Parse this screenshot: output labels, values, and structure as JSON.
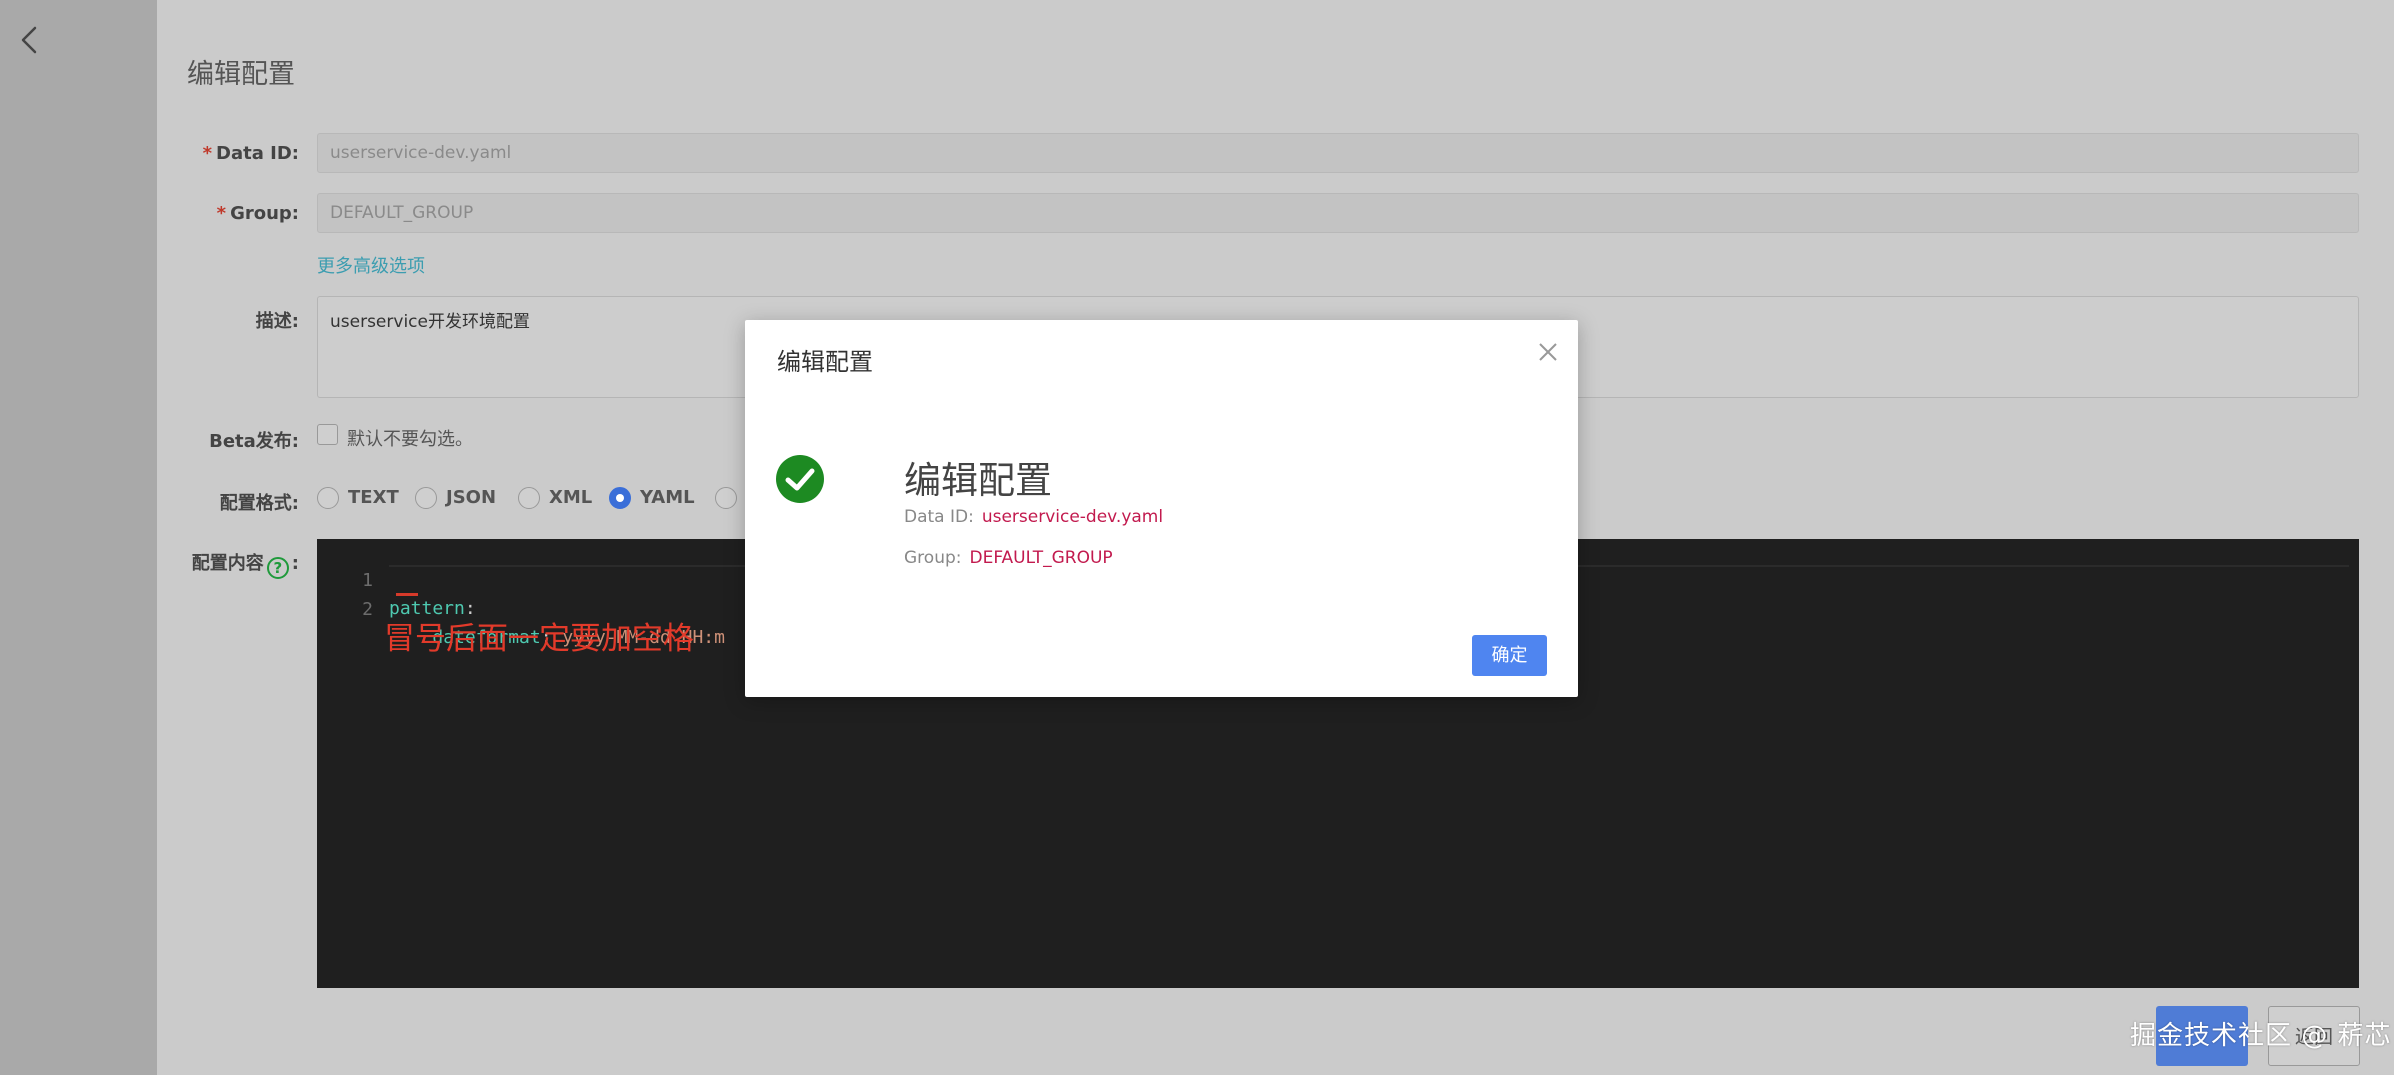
{
  "page": {
    "title": "编辑配置"
  },
  "form": {
    "data_id": {
      "label": "Data ID:",
      "value": "userservice-dev.yaml"
    },
    "group": {
      "label": "Group:",
      "value": "DEFAULT_GROUP"
    },
    "advanced_link": "更多高级选项",
    "description": {
      "label": "描述:",
      "value": "userservice开发环境配置"
    },
    "beta": {
      "label": "Beta发布:",
      "checkbox_text": "默认不要勾选。",
      "checked": false
    },
    "format": {
      "label": "配置格式:",
      "options": [
        "TEXT",
        "JSON",
        "XML",
        "YAML"
      ],
      "selected": "YAML"
    },
    "content_label": "配置内容",
    "content_label_suffix": ":",
    "help_icon_glyph": "?"
  },
  "editor": {
    "lines": [
      {
        "num": "1",
        "key": "pattern",
        "punct": ":",
        "value": ""
      },
      {
        "num": "2",
        "indent": "    ",
        "key": "dateformat",
        "punct": ":",
        "value": " yyyy-MM-dd HH:m"
      }
    ]
  },
  "annotation": {
    "text": "冒号后面一定要加空格",
    "color": "#e23a2a"
  },
  "footer": {
    "secondary_label": "返回",
    "watermark": "掘金技术社区 @ 菥芯"
  },
  "modal": {
    "title": "编辑配置",
    "heading": "编辑配置",
    "data_id_label": "Data ID:",
    "data_id_value": "userservice-dev.yaml",
    "group_label": "Group:",
    "group_value": "DEFAULT_GROUP",
    "ok_label": "确定",
    "status_icon": "success-check-icon"
  },
  "colors": {
    "accent": "#4f85f0",
    "success": "#1d8a22",
    "value_highlight": "#c21a4e"
  }
}
